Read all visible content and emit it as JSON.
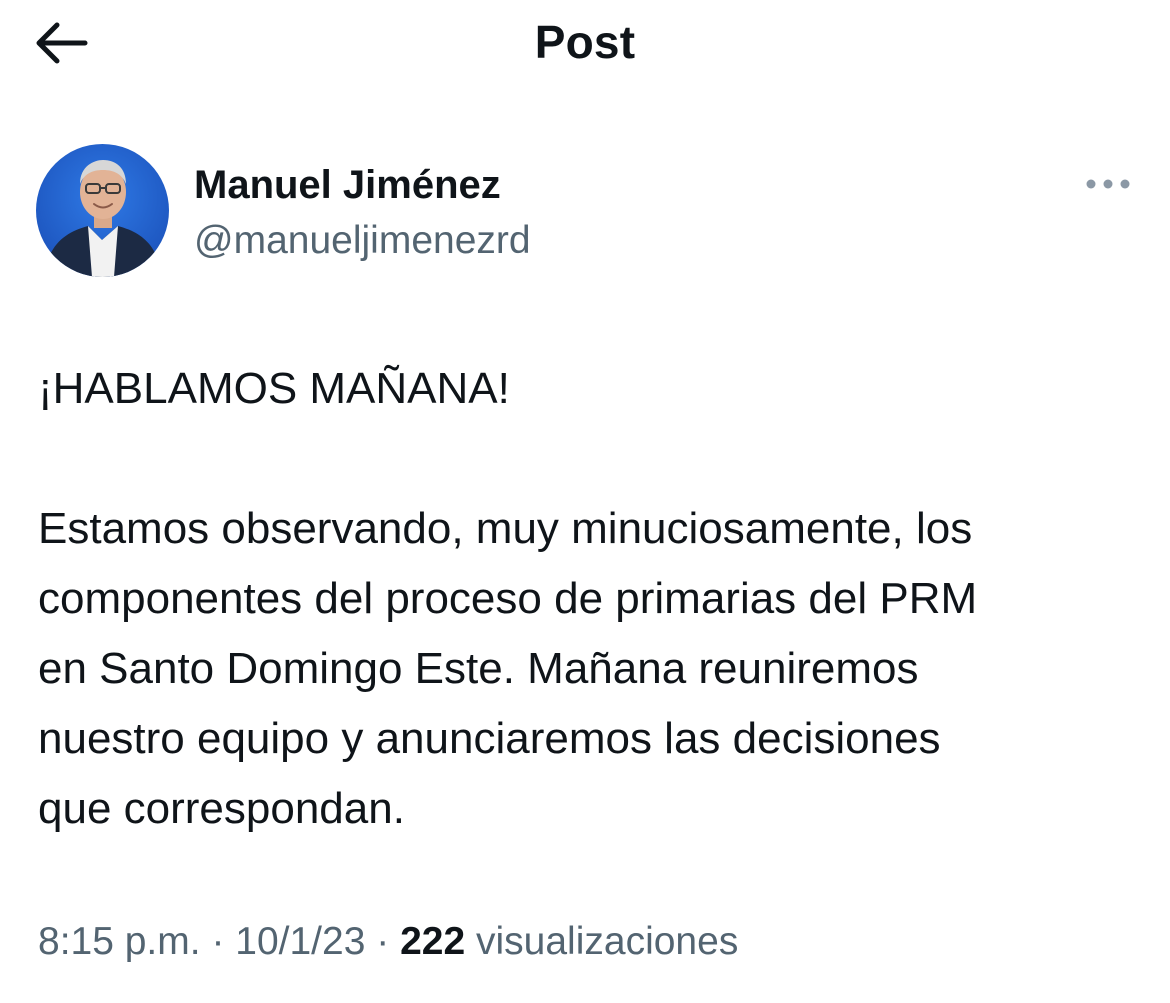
{
  "header": {
    "back_icon": "arrow-left-icon",
    "title": "Post"
  },
  "author": {
    "name": "Manuel Jiménez",
    "handle": "@manueljimenezrd",
    "more_icon": "more-horizontal-icon"
  },
  "post": {
    "headline": "¡HABLAMOS MAÑANA!",
    "lines": [
      "Estamos observando, muy minuciosamente, los",
      "componentes del proceso de primarias del PRM",
      "en Santo Domingo Este. Mañana reuniremos",
      "nuestro equipo y anunciaremos las decisiones",
      "que correspondan."
    ]
  },
  "meta": {
    "time": "8:15 p.m.",
    "separator": "·",
    "date": "10/1/23",
    "views_count": "222",
    "views_label": "visualizaciones"
  },
  "colors": {
    "text_primary": "#0f1419",
    "text_secondary": "#536471",
    "avatar_background": "#1f5fd0"
  }
}
